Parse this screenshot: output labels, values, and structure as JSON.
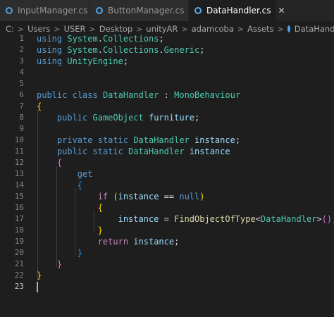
{
  "tabs": [
    {
      "label": "InputManager.cs",
      "active": false
    },
    {
      "label": "ButtonManager.cs",
      "active": false
    },
    {
      "label": "DataHandler.cs",
      "active": true,
      "close": "✕"
    }
  ],
  "breadcrumb": [
    "C:",
    "Users",
    "USER",
    "Desktop",
    "unityAR",
    "adamcoba",
    "Assets",
    "DataHandler.cs"
  ],
  "breadcrumb_separator": ">",
  "line_numbers": [
    "1",
    "2",
    "3",
    "4",
    "5",
    "6",
    "7",
    "8",
    "9",
    "10",
    "11",
    "12",
    "13",
    "14",
    "15",
    "16",
    "17",
    "18",
    "19",
    "20",
    "21",
    "22",
    "23"
  ],
  "current_line": "23",
  "code": {
    "l1": {
      "k": "using",
      "ns": "System",
      "d": ".",
      "cls": "Collections",
      "sc": ";"
    },
    "l2": {
      "k": "using",
      "ns": "System",
      "d": ".",
      "cls": "Collections",
      "d2": ".",
      "cls2": "Generic",
      "sc": ";"
    },
    "l3": {
      "k": "using",
      "ns": "UnityEngine",
      "sc": ";"
    },
    "l6": {
      "k1": "public",
      "k2": "class",
      "name": "DataHandler",
      "colon": ":",
      "base": "MonoBehaviour"
    },
    "l7": {
      "b": "{"
    },
    "l8": {
      "k": "public",
      "t": "GameObject",
      "v": "furniture",
      "sc": ";"
    },
    "l10": {
      "k1": "private",
      "k2": "static",
      "t": "DataHandler",
      "v": "instance",
      "sc": ";"
    },
    "l11": {
      "k1": "public",
      "k2": "static",
      "t": "DataHandler",
      "v": "instance"
    },
    "l12": {
      "b": "{"
    },
    "l13": {
      "k": "get"
    },
    "l14": {
      "b": "{"
    },
    "l15": {
      "k": "if",
      "p1": "(",
      "v": "instance",
      "op": "==",
      "n": "null",
      "p2": ")"
    },
    "l16": {
      "b": "{"
    },
    "l17": {
      "v": "instance",
      "eq": "=",
      "fn": "FindObjectOfType",
      "lt": "<",
      "t": "DataHandler",
      "gt": ">",
      "p": "()",
      "sc": ";"
    },
    "l18": {
      "b": "}"
    },
    "l19": {
      "k": "return",
      "v": "instance",
      "sc": ";"
    },
    "l20": {
      "b": "}"
    },
    "l21": {
      "b": "}"
    },
    "l22": {
      "b": "}"
    }
  }
}
